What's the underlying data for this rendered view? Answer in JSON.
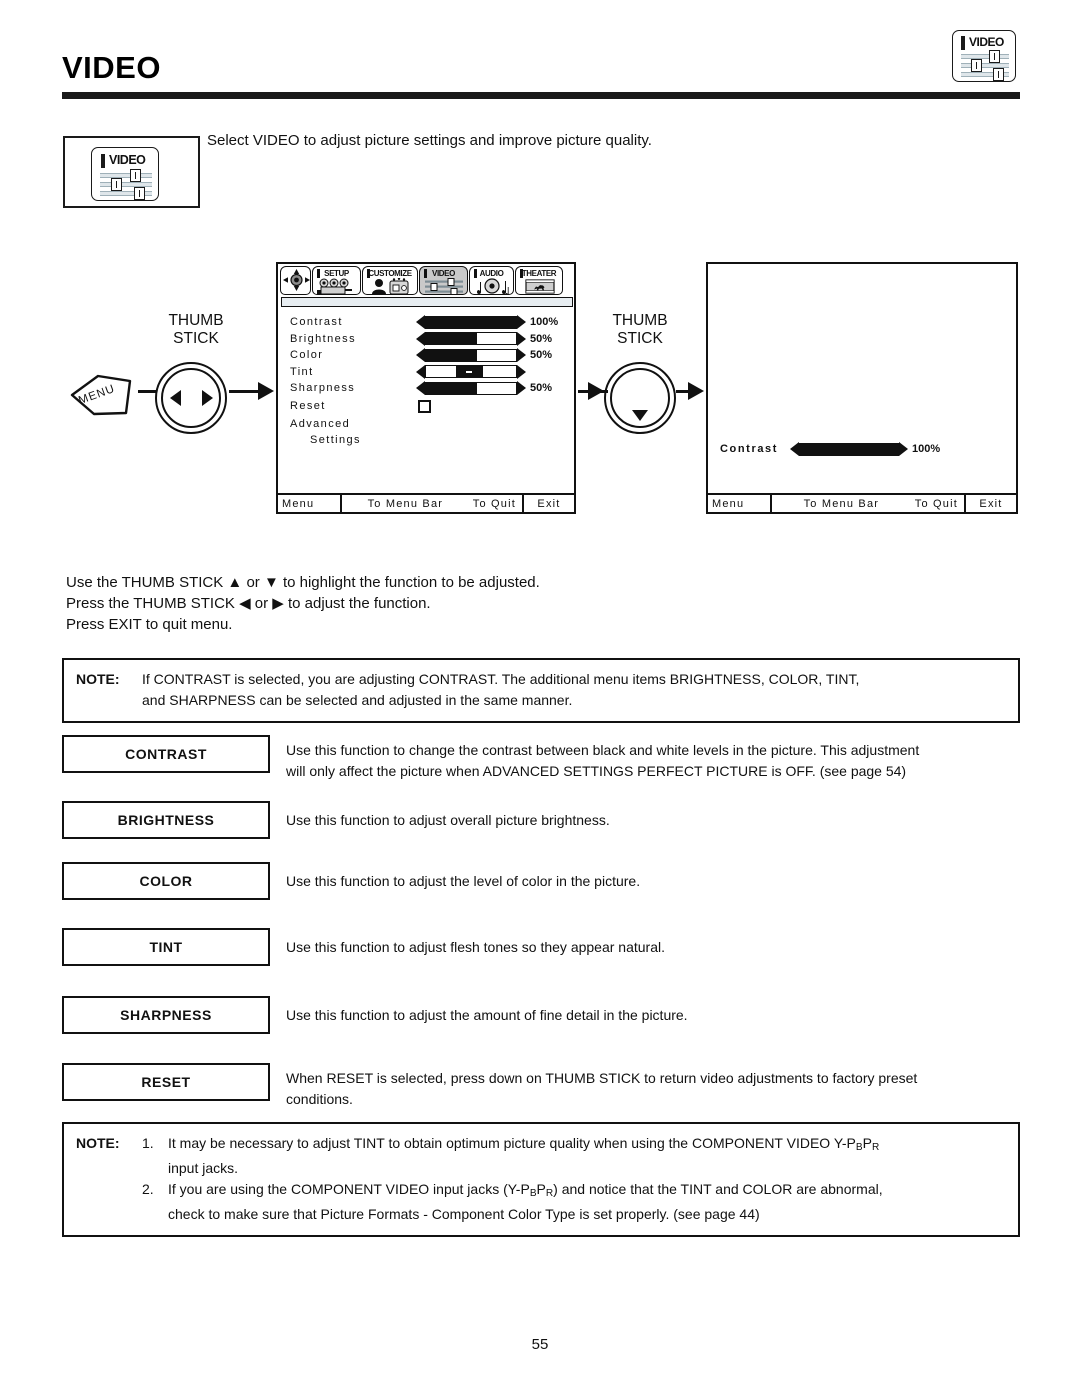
{
  "page": {
    "title": "VIDEO",
    "number": "55"
  },
  "header_icon": {
    "name": "video-icon",
    "label": "VIDEO"
  },
  "intro": {
    "icon_label": "VIDEO",
    "text": "Select VIDEO to adjust picture settings and improve picture quality."
  },
  "diagram": {
    "menu_key_label": "MENU",
    "thumb_stick_label_left": "THUMB\nSTICK",
    "thumb_stick_label_right": "THUMB\nSTICK"
  },
  "osd_left": {
    "menubar": [
      {
        "name": "",
        "icon": "nav-pad-icon",
        "selected": false
      },
      {
        "name": "SETUP",
        "icon": "camcorder-icon",
        "selected": false
      },
      {
        "name": "CUSTOMIZE",
        "icon": "person-tv-icon",
        "selected": false
      },
      {
        "name": "VIDEO",
        "icon": "sliders-icon",
        "selected": true
      },
      {
        "name": "AUDIO",
        "icon": "music-note-icon",
        "selected": false
      },
      {
        "name": "THEATER",
        "icon": "film-horse-icon",
        "selected": false
      }
    ],
    "rows": [
      {
        "label": "Contrast",
        "type": "slider",
        "fill_percent": 100,
        "value": "100%"
      },
      {
        "label": "Brightness",
        "type": "slider",
        "fill_percent": 57,
        "value": "50%"
      },
      {
        "label": "Color",
        "type": "slider",
        "fill_percent": 57,
        "value": "50%"
      },
      {
        "label": "Tint",
        "type": "centered",
        "fill_percent": 50,
        "value": ""
      },
      {
        "label": "Sharpness",
        "type": "slider",
        "fill_percent": 57,
        "value": "50%"
      },
      {
        "label": "Reset",
        "type": "checkbox",
        "fill_percent": 0,
        "value": ""
      },
      {
        "label": "Advanced",
        "type": "text",
        "fill_percent": 0,
        "value": ""
      },
      {
        "label": "Settings",
        "type": "text-indent",
        "fill_percent": 0,
        "value": ""
      }
    ],
    "footer": {
      "menu": "Menu",
      "to_menu_bar": "To Menu Bar",
      "to_quit": "To Quit",
      "exit": "Exit"
    }
  },
  "osd_right": {
    "contrast_label": "Contrast",
    "contrast_fill_percent": 100,
    "contrast_value": "100%",
    "footer": {
      "menu": "Menu",
      "to_menu_bar": "To Menu Bar",
      "to_quit": "To Quit",
      "exit": "Exit"
    }
  },
  "usage": {
    "line1": "Use the THUMB STICK ▲ or ▼ to highlight the function to be adjusted.",
    "line2": "Press the THUMB STICK ◀ or ▶ to adjust the function.",
    "line3": "Press EXIT to quit menu."
  },
  "note_top": {
    "keyword": "NOTE:",
    "line1": "If CONTRAST is selected, you are adjusting CONTRAST.  The additional menu items BRIGHTNESS, COLOR, TINT,",
    "line2": "and SHARPNESS can be selected and adjusted in the same manner."
  },
  "functions": [
    {
      "label": "CONTRAST",
      "desc_line1": "Use this function to change the contrast between black and white levels in the picture.  This adjustment",
      "desc_line2": "will only affect the picture when ADVANCED SETTINGS PERFECT PICTURE is OFF. (see page 54)"
    },
    {
      "label": "BRIGHTNESS",
      "desc_line1": "Use this function to adjust overall picture brightness.",
      "desc_line2": ""
    },
    {
      "label": "COLOR",
      "desc_line1": "Use this function to adjust the level of color in the picture.",
      "desc_line2": ""
    },
    {
      "label": "TINT",
      "desc_line1": "Use this function to adjust flesh tones so they appear natural.",
      "desc_line2": ""
    },
    {
      "label": "SHARPNESS",
      "desc_line1": "Use this function to adjust the amount of fine detail in the picture.",
      "desc_line2": ""
    },
    {
      "label": "RESET",
      "desc_line1": "When RESET is selected, press down on THUMB STICK to return video adjustments to factory preset",
      "desc_line2": "conditions."
    }
  ],
  "note_bottom": {
    "keyword": "NOTE:",
    "item1_num": "1.",
    "item1_a": "It may be necessary to adjust TINT to obtain optimum picture quality when using the COMPONENT VIDEO Y-P",
    "item1_sub1": "B",
    "item1_b": "P",
    "item1_sub2": "R",
    "item1_c": "input jacks.",
    "item2_num": "2.",
    "item2_a": "If you are using the COMPONENT VIDEO input jacks (Y-P",
    "item2_sub1": "B",
    "item2_b": "P",
    "item2_sub2": "R",
    "item2_c": ") and notice that the TINT and COLOR are abnormal,",
    "item2_d": "check to make sure that Picture Formats - Component Color Type is set properly. (see page 44)"
  }
}
